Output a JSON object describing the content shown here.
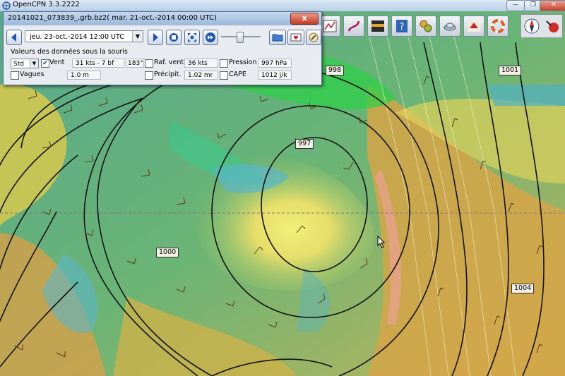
{
  "app": {
    "title": "OpenCPN 3.3.2222"
  },
  "grib": {
    "title": "20141021_073839_.grb.bz2( mar. 21-oct.-2014 00:00  UTC)",
    "close_label": "x",
    "time_value": "jeu. 23-oct.-2014 12:00  UTC",
    "data_label": "Valeurs des données sous la souris",
    "display_mode": "Std",
    "wind": {
      "label": "Vent",
      "checked": true,
      "value": "31 kts - 7 bf",
      "direction": "183°"
    },
    "gust": {
      "label": "Raf. vent",
      "checked": false,
      "value": "36 kts"
    },
    "pressure": {
      "label": "Pression",
      "checked": false,
      "value": "997 hPa"
    },
    "waves": {
      "label": "Vagues",
      "checked": false,
      "value": "1.0 m"
    },
    "precip": {
      "label": "Précipit.",
      "checked": false,
      "value": "1.02 mr"
    },
    "cape": {
      "label": "CAPE",
      "checked": false,
      "value": "1012 j/k"
    }
  },
  "chart": {
    "isobar_labels": [
      "998",
      "1001",
      "997",
      "1000",
      "1004"
    ]
  },
  "toolbar": {
    "icons": [
      "route-icon",
      "track-icon",
      "tide-icon",
      "info-icon",
      "settings-icon",
      "ais-icon",
      "mob-icon",
      "lifebuoy-icon"
    ]
  }
}
